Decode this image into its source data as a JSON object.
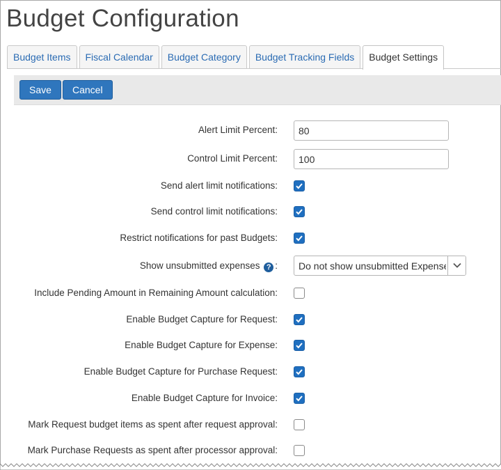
{
  "page": {
    "title": "Budget Configuration"
  },
  "tabs": [
    {
      "label": "Budget Items",
      "active": false
    },
    {
      "label": "Fiscal Calendar",
      "active": false
    },
    {
      "label": "Budget Category",
      "active": false
    },
    {
      "label": "Budget Tracking Fields",
      "active": false
    },
    {
      "label": "Budget Settings",
      "active": true
    }
  ],
  "toolbar": {
    "save_label": "Save",
    "cancel_label": "Cancel"
  },
  "form": {
    "alert_limit": {
      "label": "Alert Limit Percent:",
      "value": "80"
    },
    "control_limit": {
      "label": "Control Limit Percent:",
      "value": "100"
    },
    "send_alert": {
      "label": "Send alert limit notifications:",
      "checked": true
    },
    "send_control": {
      "label": "Send control limit notifications:",
      "checked": true
    },
    "restrict_past": {
      "label": "Restrict notifications for past Budgets:",
      "checked": true
    },
    "show_unsubmitted": {
      "label": "Show unsubmitted expenses",
      "help_icon": "?",
      "colon": ":",
      "selected": "Do not show unsubmitted Expense amounts"
    },
    "include_pending": {
      "label": "Include Pending Amount in Remaining Amount calculation:",
      "checked": false
    },
    "capture_request": {
      "label": "Enable Budget Capture for Request:",
      "checked": true
    },
    "capture_expense": {
      "label": "Enable Budget Capture for Expense:",
      "checked": true
    },
    "capture_purchase": {
      "label": "Enable Budget Capture for Purchase Request:",
      "checked": true
    },
    "capture_invoice": {
      "label": "Enable Budget Capture for Invoice:",
      "checked": true
    },
    "mark_request_spent": {
      "label": "Mark Request budget items as spent after request approval:",
      "checked": false
    },
    "mark_purchase_spent": {
      "label": "Mark Purchase Requests as spent after processor approval:",
      "checked": false
    }
  },
  "colors": {
    "primary_button": "#2f76bd",
    "checkbox_checked": "#1f6fc0",
    "tab_link": "#2a6bb3",
    "toolbar_bg": "#e9e9e9"
  }
}
